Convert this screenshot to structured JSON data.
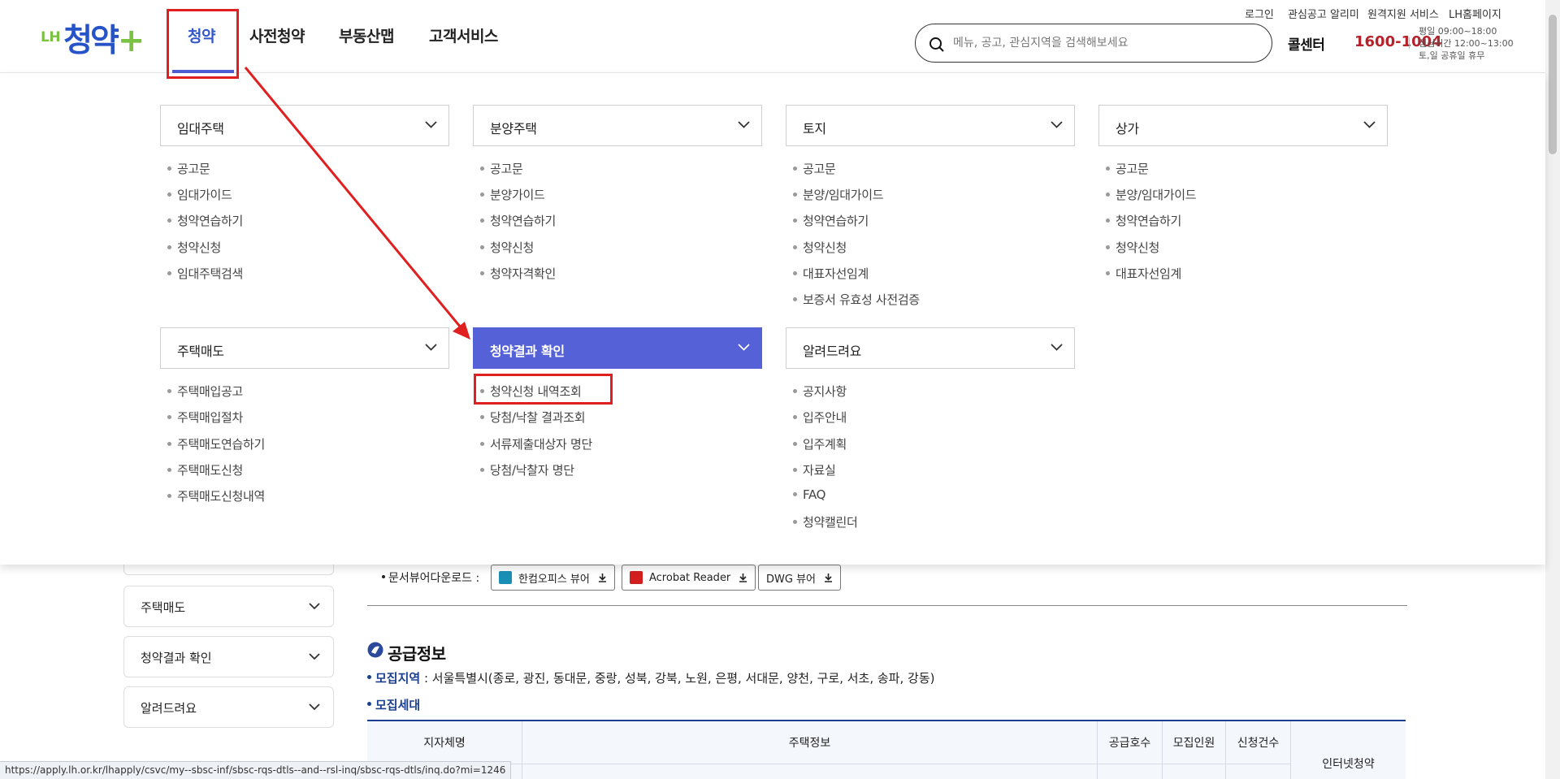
{
  "header": {
    "logo": {
      "prefix": "LH",
      "name": "청약",
      "plus": "+"
    },
    "gnb": [
      "청약",
      "사전청약",
      "부동산맵",
      "고객서비스"
    ],
    "util_links": [
      "로그인",
      "관심공고 알리미",
      "원격지원 서비스",
      "LH홈페이지"
    ],
    "search": {
      "placeholder": "메뉴, 공고, 관심지역을 검색해보세요"
    },
    "call_center": {
      "label": "콜센터",
      "number": "1600-1004",
      "hours": [
        "평일 09:00~18:00",
        "점심시간 12:00~13:00",
        "토,일 공휴일 휴무"
      ]
    }
  },
  "mega_menu": {
    "categories": [
      {
        "title": "임대주택",
        "items": [
          "공고문",
          "임대가이드",
          "청약연습하기",
          "청약신청",
          "임대주택검색"
        ]
      },
      {
        "title": "분양주택",
        "items": [
          "공고문",
          "분양가이드",
          "청약연습하기",
          "청약신청",
          "청약자격확인"
        ]
      },
      {
        "title": "토지",
        "items": [
          "공고문",
          "분양/임대가이드",
          "청약연습하기",
          "청약신청",
          "대표자선임계",
          "보증서 유효성 사전검증"
        ]
      },
      {
        "title": "상가",
        "items": [
          "공고문",
          "분양/임대가이드",
          "청약연습하기",
          "청약신청",
          "대표자선임계"
        ]
      },
      {
        "title": "주택매도",
        "items": [
          "주택매입공고",
          "주택매입절차",
          "주택매도연습하기",
          "주택매도신청",
          "주택매도신청내역"
        ]
      },
      {
        "title": "청약결과 확인",
        "items": [
          "청약신청 내역조회",
          "당첨/낙찰 결과조회",
          "서류제출대상자 명단",
          "당첨/낙찰자 명단"
        ]
      },
      {
        "title": "알려드려요",
        "items": [
          "공지사항",
          "입주안내",
          "입주계획",
          "자료실",
          "FAQ",
          "청약캘린더"
        ]
      }
    ]
  },
  "sidebar": {
    "items": [
      "주택매도",
      "청약결과 확인",
      "알려드려요"
    ]
  },
  "viewers": {
    "label": "문서뷰어다운로드 :",
    "buttons": [
      "한컴오피스 뷰어",
      "Acrobat Reader",
      "DWG 뷰어"
    ]
  },
  "supply_info": {
    "title": "공급정보",
    "region_key": "모집지역",
    "region_value": " : 서울특별시(종로, 광진, 동대문, 중랑, 성북, 강북, 노원, 은평, 서대문, 양천, 구로, 서초, 송파, 강동)",
    "households_key": "모집세대",
    "table_headers": [
      "지자체명",
      "주택정보",
      "공급호수",
      "모집인원",
      "신청건수",
      "인터넷청약"
    ]
  },
  "status_url": "https://apply.lh.or.kr/lhapply/csvc/my--sbsc-inf/sbsc-rqs-dtls--and--rsl-inq/sbsc-rqs-dtls/inq.do?mi=1246",
  "colors": {
    "accent": "#5561d6",
    "brand_blue": "#2654c8",
    "brand_green": "#7cc242",
    "highlight_red": "#e02020",
    "phone_red": "#b5222b"
  }
}
